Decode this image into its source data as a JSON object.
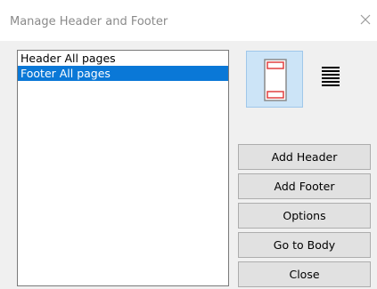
{
  "dialog": {
    "title": "Manage Header and Footer",
    "close_icon": "close-icon"
  },
  "list": {
    "items": [
      {
        "label": "Header All pages",
        "selected": false
      },
      {
        "label": "Footer All pages",
        "selected": true
      }
    ]
  },
  "view_buttons": [
    {
      "icon": "page-header-footer-icon",
      "active": true
    },
    {
      "icon": "body-text-lines-icon",
      "active": false
    }
  ],
  "buttons": {
    "add_header": "Add Header",
    "add_footer": "Add Footer",
    "options": "Options",
    "go_to_body": "Go to Body",
    "close": "Close"
  },
  "colors": {
    "selection": "#0a78d7",
    "active_view_bg": "#cce4f7",
    "header_footer_marker": "#e04040"
  }
}
